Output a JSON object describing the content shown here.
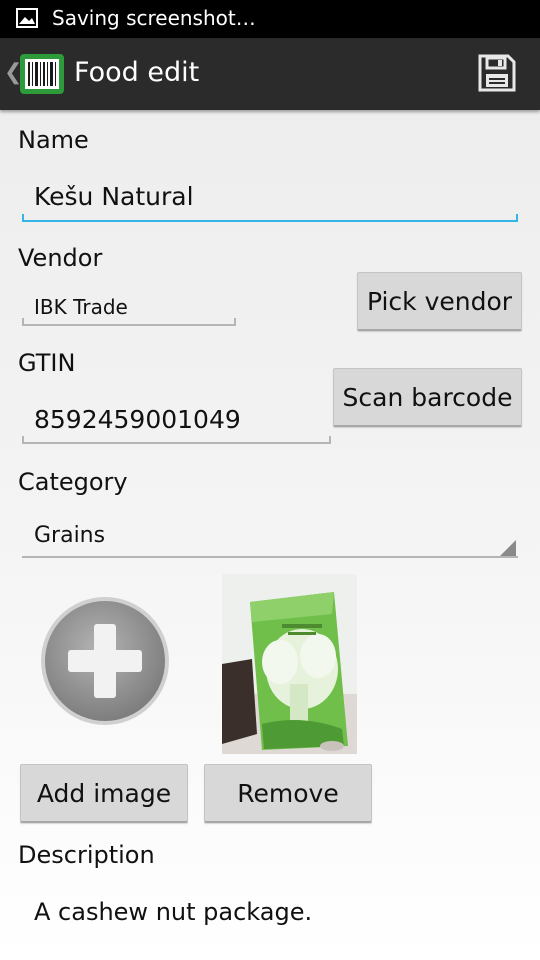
{
  "status_bar": {
    "text": "Saving screenshot…"
  },
  "action_bar": {
    "title": "Food edit",
    "app_icon": "barcode-icon",
    "action_icon": "save-icon"
  },
  "form": {
    "name": {
      "label": "Name",
      "value": "Kešu Natural"
    },
    "vendor": {
      "label": "Vendor",
      "value": "IBK Trade",
      "button": "Pick vendor"
    },
    "gtin": {
      "label": "GTIN",
      "value": "8592459001049",
      "button": "Scan barcode"
    },
    "category": {
      "label": "Category",
      "selected": "Grains"
    },
    "images": {
      "add_button": "Add image",
      "remove_button": "Remove",
      "add_icon": "add-circle-icon"
    },
    "description": {
      "label": "Description",
      "value": "A cashew nut package."
    }
  },
  "colors": {
    "accent": "#33b5e5",
    "action_bar": "#2b2b2b",
    "status_bar": "#000000",
    "button": "#d8d8d8"
  }
}
